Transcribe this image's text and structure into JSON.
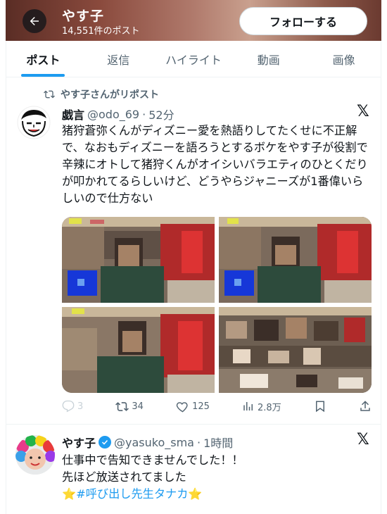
{
  "header": {
    "name": "やす子",
    "post_count": "14,551件のポスト",
    "follow_label": "フォローする"
  },
  "tabs": [
    {
      "label": "ポスト",
      "active": true
    },
    {
      "label": "返信",
      "active": false
    },
    {
      "label": "ハイライト",
      "active": false
    },
    {
      "label": "動画",
      "active": false
    },
    {
      "label": "画像",
      "active": false
    }
  ],
  "post1": {
    "repost_label": "やす子さんがリポスト",
    "author_name": "戯言",
    "handle": "@odo_69",
    "time": "52分",
    "text": "猪狩蒼弥くんがディズニー愛を熱語りしてたくせに不正解で、なおもディズニーを語ろうとするボケをやす子が役割で辛辣にオトして猪狩くんがオイシいバラエティのひとくだりが叩かれてるらしいけど、どうやらジャニーズが1番偉いらしいので仕方ない",
    "stats": {
      "replies": "3",
      "reposts": "34",
      "likes": "125",
      "views": "2.8万"
    }
  },
  "post2": {
    "author_name": "やす子",
    "handle": "@yasuko_sma",
    "time": "1時間",
    "line1": "仕事中で告知できませんでした！！",
    "line2": "先ほど放送されてました",
    "hashtag_line": "⭐#呼び出し先生タナカ⭐"
  },
  "colors": {
    "accent": "#1d9bf0",
    "text_primary": "#0f1419",
    "text_secondary": "#536471"
  }
}
